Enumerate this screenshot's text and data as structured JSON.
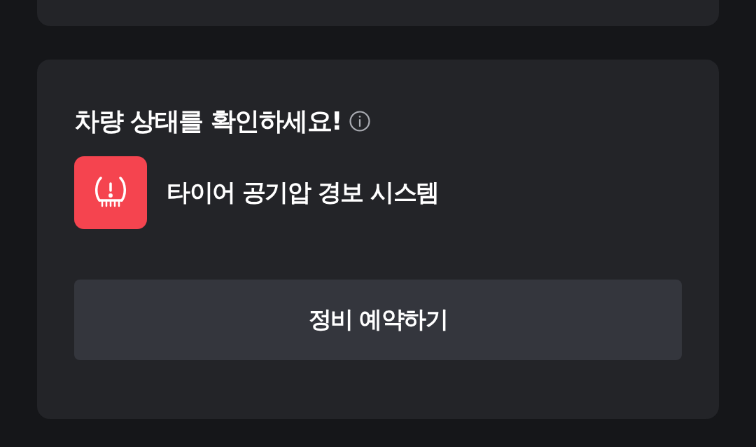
{
  "status_card": {
    "title": "차량 상태를 확인하세요!",
    "alerts": [
      {
        "kind": "tire_pressure",
        "label": "타이어 공기압 경보 시스템"
      }
    ],
    "button": "정비 예약하기"
  }
}
